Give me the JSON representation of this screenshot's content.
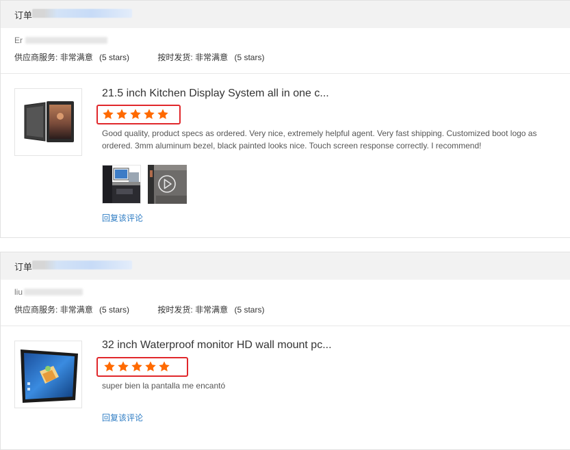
{
  "reviews": [
    {
      "order_label": "订单",
      "buyer": "Er",
      "supplier_service_label": "供应商服务:",
      "supplier_service_value": "非常满意",
      "supplier_service_stars": "(5 stars)",
      "shipping_label": "按时发货:",
      "shipping_value": "非常满意",
      "shipping_stars": "(5 stars)",
      "product_title": "21.5 inch Kitchen Display System all in one c...",
      "rating": 5,
      "review_text": "Good quality, product specs as ordered. Very nice, extremely helpful agent. Very fast shipping. Customized boot logo as ordered. 3mm aluminum bezel, black painted looks nice. Touch screen response correctly. I recommend!",
      "reply_label": "回复该评论"
    },
    {
      "order_label": "订单",
      "buyer": "liu",
      "supplier_service_label": "供应商服务:",
      "supplier_service_value": "非常满意",
      "supplier_service_stars": "(5 stars)",
      "shipping_label": "按时发货:",
      "shipping_value": "非常满意",
      "shipping_stars": "(5 stars)",
      "product_title": "32 inch Waterproof monitor HD wall mount pc...",
      "rating": 5,
      "review_text": "super bien la pantalla me encantó",
      "reply_label": "回复该评论"
    }
  ],
  "colors": {
    "star": "#ff6a00",
    "highlight_box": "#e0262a",
    "link": "#2f7dc4"
  }
}
